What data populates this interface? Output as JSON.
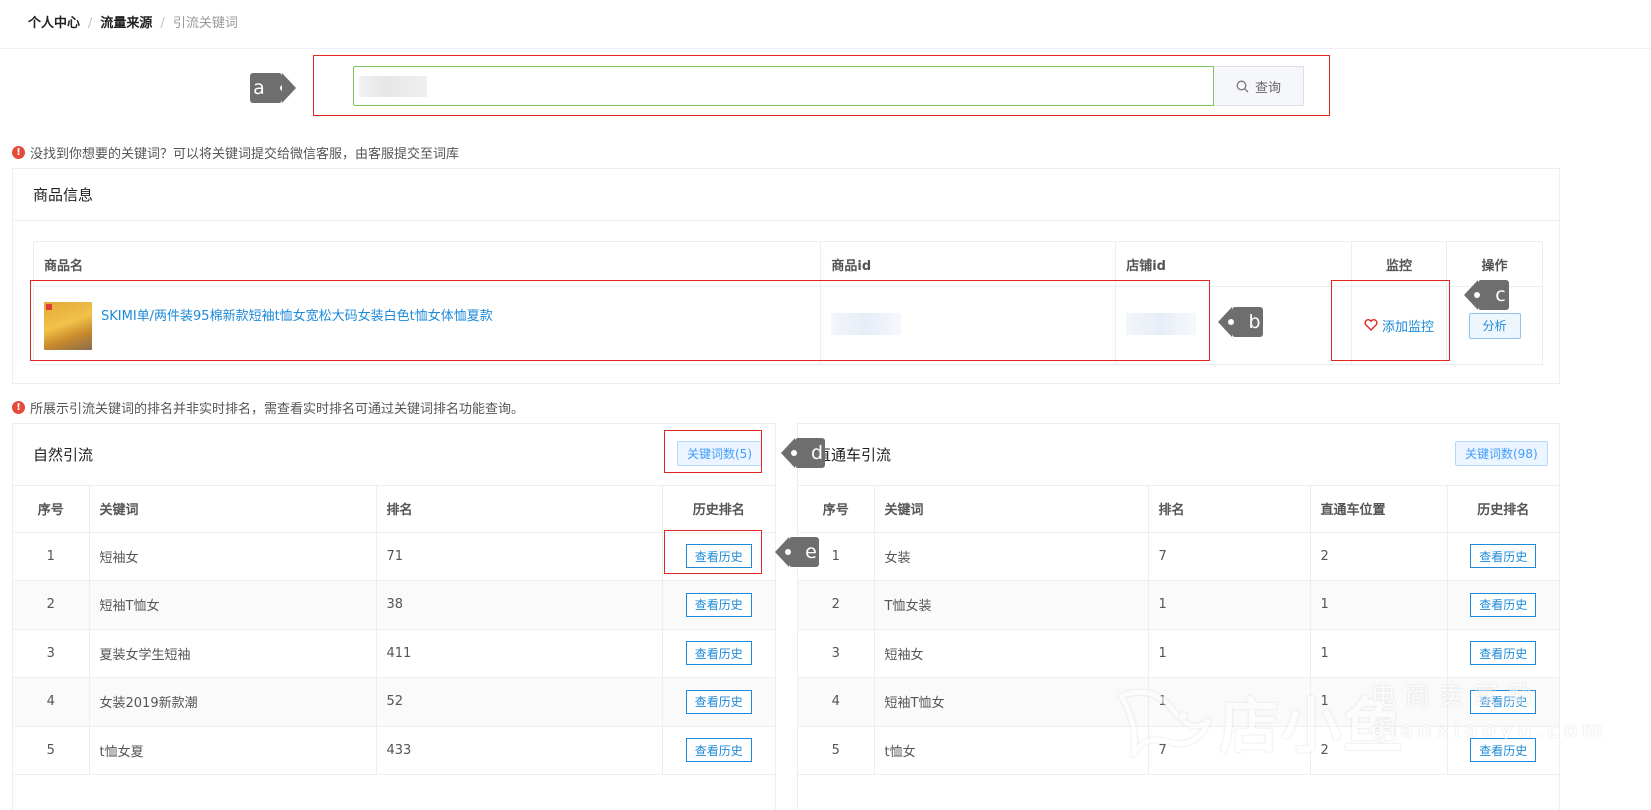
{
  "breadcrumb": {
    "home": "个人中心",
    "traffic": "流量来源",
    "current": "引流关键词"
  },
  "search": {
    "value": "",
    "button_label": "查询"
  },
  "notices": {
    "top": "没找到你想要的关键词？可以将关键词提交给微信客服，由客服提交至词库",
    "ranking": "所展示引流关键词的排名并非实时排名，需查看实时排名可通过关键词排名功能查询。"
  },
  "product_card": {
    "title": "商品信息",
    "headers": {
      "name": "商品名",
      "item_id": "商品id",
      "shop_id": "店铺id",
      "monitor": "监控",
      "action": "操作"
    },
    "product": {
      "name": "SKIMI单/两件装95棉新款短袖t恤女宽松大码女装白色t恤女体恤夏款",
      "monitor_label": "添加监控",
      "analyze_label": "分析"
    }
  },
  "natural": {
    "title": "自然引流",
    "count_label": "关键词数(5)",
    "headers": {
      "index": "序号",
      "keyword": "关键词",
      "rank": "排名",
      "history": "历史排名"
    },
    "rows": [
      {
        "index": "1",
        "keyword": "短袖女",
        "rank": "71",
        "history": "查看历史"
      },
      {
        "index": "2",
        "keyword": "短袖T恤女",
        "rank": "38",
        "history": "查看历史"
      },
      {
        "index": "3",
        "keyword": "夏装女学生短袖",
        "rank": "411",
        "history": "查看历史"
      },
      {
        "index": "4",
        "keyword": "女装2019新款潮",
        "rank": "52",
        "history": "查看历史"
      },
      {
        "index": "5",
        "keyword": "t恤女夏",
        "rank": "433",
        "history": "查看历史"
      }
    ]
  },
  "paid": {
    "title": "直通车引流",
    "count_label": "关键词数(98)",
    "headers": {
      "index": "序号",
      "keyword": "关键词",
      "rank": "排名",
      "position": "直通车位置",
      "history": "历史排名"
    },
    "rows": [
      {
        "index": "1",
        "keyword": "女装",
        "rank": "7",
        "position": "2",
        "history": "查看历史"
      },
      {
        "index": "2",
        "keyword": "T恤女装",
        "rank": "1",
        "position": "1",
        "history": "查看历史"
      },
      {
        "index": "3",
        "keyword": "短袖女",
        "rank": "1",
        "position": "1",
        "history": "查看历史"
      },
      {
        "index": "4",
        "keyword": "短袖T恤女",
        "rank": "1",
        "position": "1",
        "history": "查看历史"
      },
      {
        "index": "5",
        "keyword": "t恤女",
        "rank": "7",
        "position": "2",
        "history": "查看历史"
      }
    ]
  },
  "annotations": {
    "a": "a",
    "b": "b",
    "c": "c",
    "d": "d",
    "e": "e"
  },
  "watermark": {
    "brand": "店小鱼",
    "slogan": "电商卖家助手",
    "url": "dianxiaoyu.com"
  },
  "colors": {
    "link": "#1d8ad9",
    "annotation_red": "#e0281f",
    "tag_gray": "#6e6e6e",
    "warning": "#e64a3c"
  }
}
